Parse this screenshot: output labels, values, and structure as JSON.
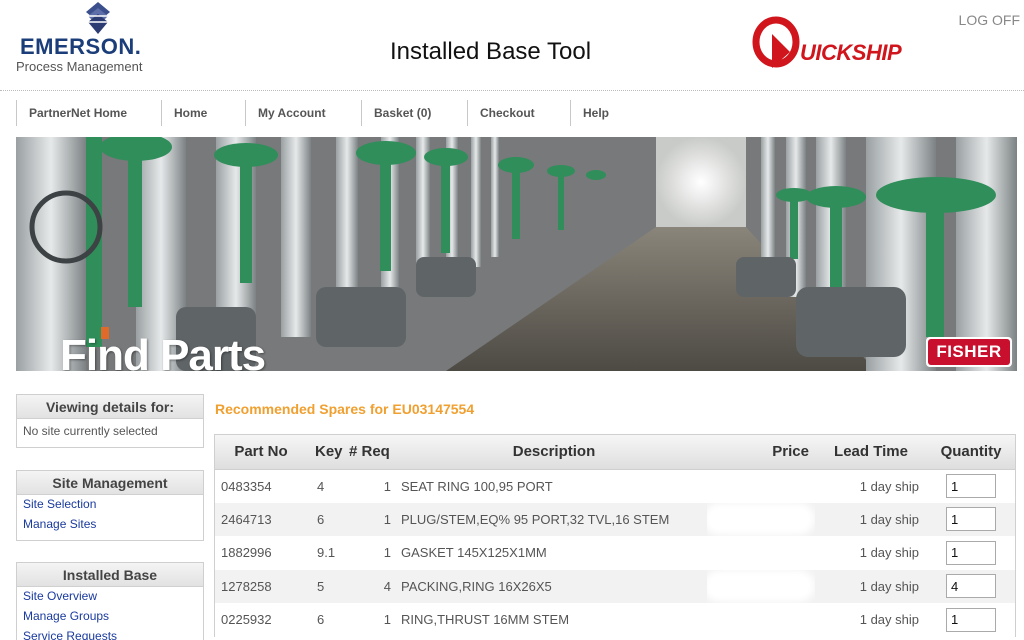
{
  "header": {
    "brand": "EMERSON.",
    "brand_sub": "Process Management",
    "title": "Installed Base Tool",
    "quickship": "UICKSHIP",
    "logoff": "LOG OFF"
  },
  "nav": [
    {
      "label": "PartnerNet Home"
    },
    {
      "label": "Home"
    },
    {
      "label": "My Account"
    },
    {
      "label": "Basket (0)"
    },
    {
      "label": "Checkout"
    },
    {
      "label": "Help"
    }
  ],
  "banner": {
    "title": "Find Parts",
    "badge": "FISHER"
  },
  "sidebar": {
    "viewing": {
      "heading": "Viewing details for:",
      "text": "No site currently selected"
    },
    "site_management": {
      "heading": "Site Management",
      "links": [
        "Site Selection",
        "Manage Sites"
      ]
    },
    "installed_base": {
      "heading": "Installed Base",
      "links": [
        "Site Overview",
        "Manage Groups",
        "Service Requests"
      ]
    }
  },
  "main": {
    "title": "Recommended Spares for  EU03147554",
    "columns": [
      "Part No",
      "Key",
      "# Req",
      "Description",
      "Price",
      "Lead Time",
      "Quantity"
    ],
    "rows": [
      {
        "part_no": "0483354",
        "key": "4",
        "req": "1",
        "description": "SEAT RING 100,95 PORT",
        "lead_time": "1 day ship",
        "quantity": "1"
      },
      {
        "part_no": "2464713",
        "key": "6",
        "req": "1",
        "description": "PLUG/STEM,EQ% 95 PORT,32 TVL,16 STEM",
        "lead_time": "1 day ship",
        "quantity": "1"
      },
      {
        "part_no": "1882996",
        "key": "9.1",
        "req": "1",
        "description": "GASKET 145X125X1MM",
        "lead_time": "1 day ship",
        "quantity": "1"
      },
      {
        "part_no": "1278258",
        "key": "5",
        "req": "4",
        "description": "PACKING,RING 16X26X5",
        "lead_time": "1 day ship",
        "quantity": "4"
      },
      {
        "part_no": "0225932",
        "key": "6",
        "req": "1",
        "description": "RING,THRUST 16MM STEM",
        "lead_time": "1 day ship",
        "quantity": "1"
      }
    ]
  },
  "colors": {
    "brand_blue": "#1b3e7a",
    "link_blue": "#1a3a9e",
    "accent_orange": "#f0a030",
    "quickship_red": "#d0151c",
    "fisher_red": "#c8102e"
  },
  "icons": [
    "emerson-diamond-icon",
    "quickship-q-icon"
  ]
}
